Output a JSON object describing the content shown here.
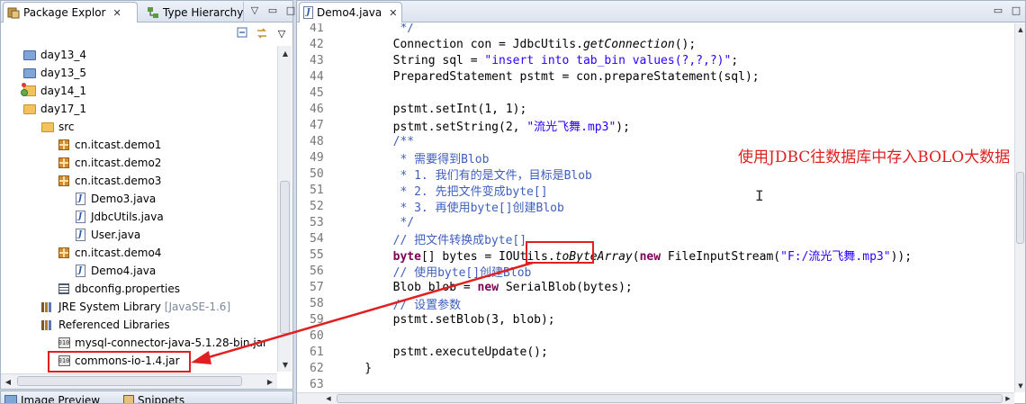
{
  "left_panel": {
    "tabs": [
      {
        "label": "Package Explor",
        "close": "✕"
      },
      {
        "label": "Type Hierarchy"
      }
    ],
    "window_buttons": [
      "▽",
      "▭",
      "□"
    ],
    "tree": [
      {
        "label": "day13_4",
        "icon": "folder-closed-icon"
      },
      {
        "label": "day13_5",
        "icon": "folder-closed-icon"
      },
      {
        "label": "day14_1",
        "icon": "project-warning-icon"
      },
      {
        "label": "day17_1",
        "icon": "project-icon"
      },
      {
        "label": "src",
        "icon": "source-folder-icon"
      },
      {
        "label": "cn.itcast.demo1",
        "icon": "package-icon"
      },
      {
        "label": "cn.itcast.demo2",
        "icon": "package-icon"
      },
      {
        "label": "cn.itcast.demo3",
        "icon": "package-icon"
      },
      {
        "label": "Demo3.java",
        "icon": "java-file-icon"
      },
      {
        "label": "JdbcUtils.java",
        "icon": "java-file-icon"
      },
      {
        "label": "User.java",
        "icon": "java-file-icon"
      },
      {
        "label": "cn.itcast.demo4",
        "icon": "package-icon"
      },
      {
        "label": "Demo4.java",
        "icon": "java-file-icon"
      },
      {
        "label": "dbconfig.properties",
        "icon": "properties-file-icon"
      },
      {
        "label": "JRE System Library",
        "suffix": "[JavaSE-1.6]",
        "icon": "library-icon"
      },
      {
        "label": "Referenced Libraries",
        "icon": "library-icon"
      },
      {
        "label": "mysql-connector-java-5.1.28-bin.jar",
        "icon": "jar-icon"
      },
      {
        "label": "commons-io-1.4.jar",
        "icon": "jar-icon"
      }
    ],
    "bottom_tabs": [
      "Image Preview",
      "Snippets"
    ]
  },
  "editor": {
    "tab_label": "Demo4.java",
    "tab_close": "✕",
    "window_buttons": [
      "▭",
      "□"
    ],
    "lines": [
      {
        "n": "41",
        "text": "         */"
      },
      {
        "n": "42",
        "text": "        Connection con = JdbcUtils.getConnection();"
      },
      {
        "n": "43",
        "text": "        String sql = \"insert into tab_bin values(?,?,?)\";"
      },
      {
        "n": "44",
        "text": "        PreparedStatement pstmt = con.prepareStatement(sql);"
      },
      {
        "n": "45",
        "text": ""
      },
      {
        "n": "46",
        "text": "        pstmt.setInt(1, 1);"
      },
      {
        "n": "47",
        "text": "        pstmt.setString(2, \"流光飞舞.mp3\");"
      },
      {
        "n": "48",
        "text": "        /**"
      },
      {
        "n": "49",
        "text": "         * 需要得到Blob"
      },
      {
        "n": "50",
        "text": "         * 1. 我们有的是文件，目标是Blob"
      },
      {
        "n": "51",
        "text": "         * 2. 先把文件变成byte[]"
      },
      {
        "n": "52",
        "text": "         * 3. 再使用byte[]创建Blob"
      },
      {
        "n": "53",
        "text": "         */"
      },
      {
        "n": "54",
        "text": "        // 把文件转换成byte[]"
      },
      {
        "n": "55",
        "text": "        byte[] bytes = IOUtils.toByteArray(new FileInputStream(\"F:/流光飞舞.mp3\"));"
      },
      {
        "n": "56",
        "text": "        // 使用byte[]创建Blob"
      },
      {
        "n": "57",
        "text": "        Blob blob = new SerialBlob(bytes);"
      },
      {
        "n": "58",
        "text": "        // 设置参数"
      },
      {
        "n": "59",
        "text": "        pstmt.setBlob(3, blob);"
      },
      {
        "n": "60",
        "text": ""
      },
      {
        "n": "61",
        "text": "        pstmt.executeUpdate();"
      },
      {
        "n": "62",
        "text": "    }"
      },
      {
        "n": "63",
        "text": ""
      }
    ]
  },
  "annotation": {
    "text": "使用JDBC往数据库中存入BOLO大数据",
    "color": "#e02020"
  },
  "colors": {
    "keyword": "#7f0055",
    "string": "#2a00ff",
    "comment": "#3f5fbf",
    "highlight_box": "#e02020"
  }
}
